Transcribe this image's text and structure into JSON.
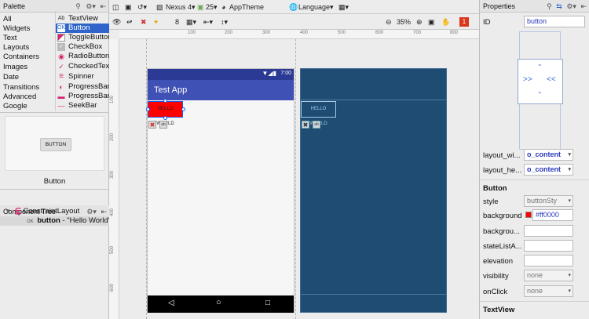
{
  "palette": {
    "title": "Palette",
    "categories": [
      "All",
      "Widgets",
      "Text",
      "Layouts",
      "Containers",
      "Images",
      "Date",
      "Transitions",
      "Advanced",
      "Google"
    ],
    "items": [
      {
        "label": "TextView",
        "icon": "Ab"
      },
      {
        "label": "Button",
        "icon": "OK"
      },
      {
        "label": "ToggleButton",
        "icon": "toggle-icon"
      },
      {
        "label": "CheckBox",
        "icon": "checkbox-icon"
      },
      {
        "label": "RadioButton",
        "icon": "radio-icon"
      },
      {
        "label": "CheckedTextView",
        "icon": "checked-text-icon"
      },
      {
        "label": "Spinner",
        "icon": "spinner-icon"
      },
      {
        "label": "ProgressBar",
        "icon": "progress-icon"
      },
      {
        "label": "ProgressBar",
        "icon": "progress-horizontal-icon"
      },
      {
        "label": "SeekBar",
        "icon": "seekbar-icon"
      }
    ],
    "selected_item": "Button",
    "preview_button": "BUTTON",
    "preview_name": "Button"
  },
  "component_tree": {
    "title": "Component Tree",
    "root": "ConstraintLayout",
    "child_icon": "OK",
    "child_name": "button",
    "child_text": "- \"Hello World\""
  },
  "toolbar": {
    "device": "Nexus 4",
    "api": "25",
    "theme": "AppTheme",
    "language": "Language",
    "number": "8",
    "zoom": "35%",
    "error_count": "1"
  },
  "ruler": {
    "top": [
      "100",
      "200",
      "300",
      "400",
      "500",
      "600",
      "700",
      "800"
    ],
    "left": [
      "100",
      "200",
      "300",
      "400",
      "500",
      "600"
    ]
  },
  "device": {
    "time": "7:00",
    "app_title": "Test App",
    "button_text": "HELLO WORLD"
  },
  "blueprint": {
    "button_text": "HELLO WORLD"
  },
  "properties": {
    "title": "Properties",
    "id_label": "ID",
    "id_value": "button",
    "layout_width_label": "layout_wi...",
    "layout_width_value": "o_content",
    "layout_height_label": "layout_he...",
    "layout_height_value": "o_content",
    "section_button": "Button",
    "style_label": "style",
    "style_value": "buttonSty",
    "background_label": "background",
    "background_value": "#ff0000",
    "background_color": "#ff0000",
    "backgroundtint_label": "backgrou...",
    "statelist_label": "stateListA...",
    "elevation_label": "elevation",
    "visibility_label": "visibility",
    "visibility_value": "none",
    "onclick_label": "onClick",
    "onclick_value": "none",
    "section_textview": "TextView"
  },
  "colors": {
    "accent": "#2f65ca",
    "blueprint": "#1e4c73",
    "appbar": "#3f51b5",
    "statusbar": "#2a3a95"
  }
}
